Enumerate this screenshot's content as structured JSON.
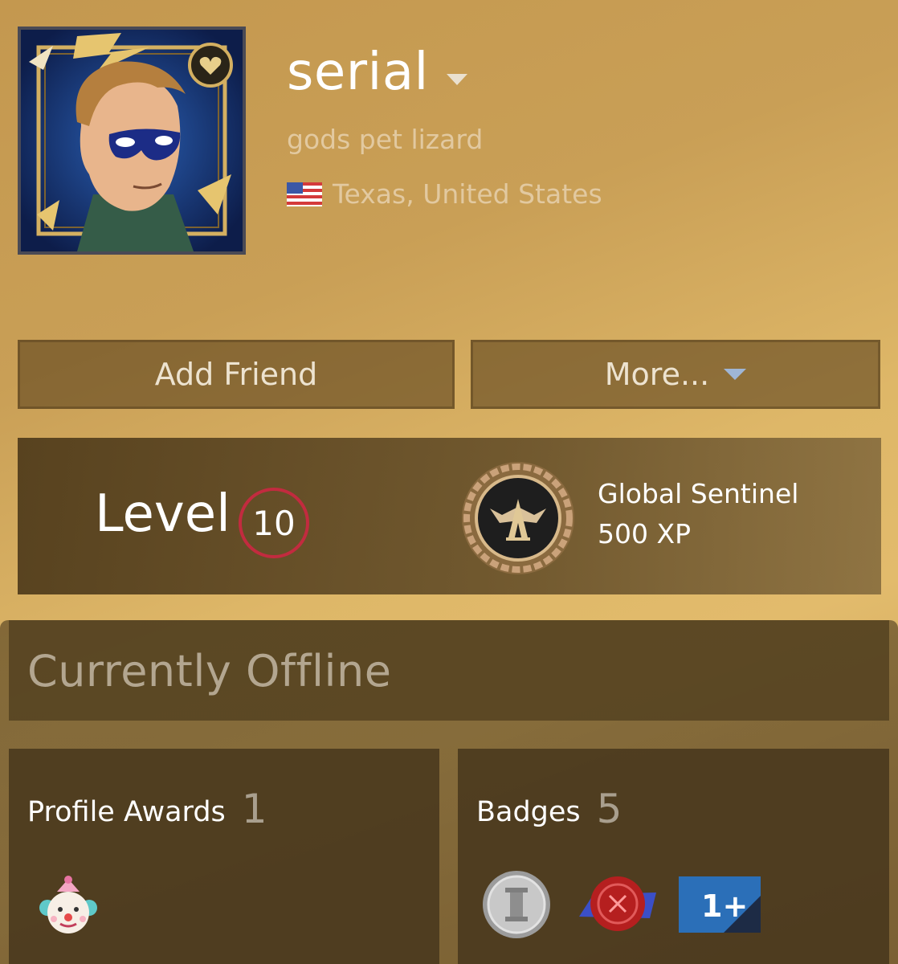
{
  "profile": {
    "persona_name": "serial",
    "real_name": "gods pet lizard",
    "location": "Texas, United States",
    "flag_icon": "us-flag-icon",
    "avatar_icon": "hero-avatar-icon"
  },
  "actions": {
    "add_friend": "Add Friend",
    "more": "More..."
  },
  "level": {
    "label": "Level",
    "value": "10",
    "ring_color": "#c22b3f",
    "featured_badge": {
      "name": "Global Sentinel",
      "xp": "500 XP",
      "icon": "global-sentinel-emblem-icon"
    }
  },
  "status": {
    "text": "Currently Offline"
  },
  "awards": {
    "title": "Profile Awards",
    "count": "1",
    "items": [
      "clown-award-icon"
    ]
  },
  "badges": {
    "title": "Badges",
    "count": "5",
    "items": [
      "silver-pillar-badge-icon",
      "wax-seal-badge-icon",
      "one-plus-badge-icon"
    ]
  },
  "colors": {
    "background": "#d6ae62",
    "accent_red": "#c22b3f",
    "badge_blue": "#2b6fb8"
  }
}
